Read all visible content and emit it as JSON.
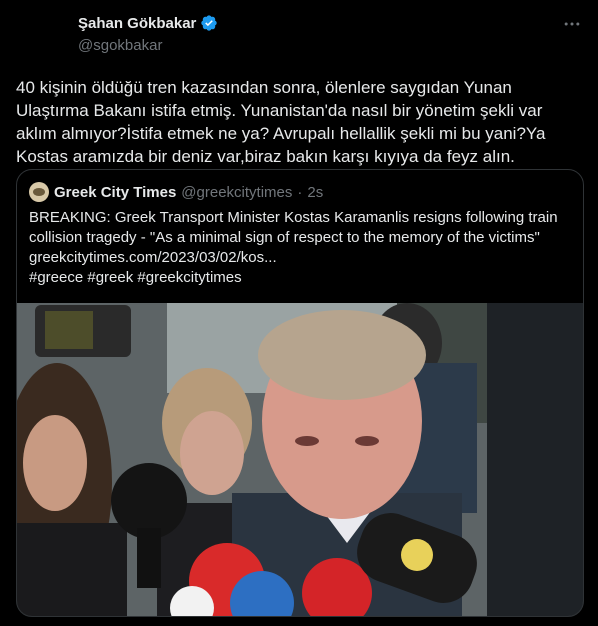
{
  "author": {
    "name": "Şahan Gökbakar",
    "handle": "@sgokbakar",
    "verified_icon": "verified-badge-icon",
    "badge_color": "#1d9bf0"
  },
  "more_icon": "more-horizontal-icon",
  "tweet": {
    "lines": [
      "40 kişinin öldüğü tren kazasından sonra, ölenlere saygıdan Yunan",
      "Ulaştırma Bakanı istifa etmiş. Yunanistan'da nasıl bir yönetim şekli var",
      "aklım almıyor?İstifa etmek ne ya? Avrupalı hellallik şekli mi bu yani?Ya",
      "Kostas aramızda bir deniz var,biraz bakın karşı kıyıya da feyz alın."
    ]
  },
  "quote": {
    "name": "Greek City Times",
    "handle": "@greekcitytimes",
    "separator": "·",
    "time": "2s",
    "lines": [
      "BREAKING: Greek Transport Minister Kostas Karamanlis resigns following train",
      "collision tragedy - \"As a minimal sign of respect to the memory of the victims\"",
      "greekcitytimes.com/2023/03/02/kos...",
      "#greece #greek #greekcitytimes"
    ]
  },
  "colors": {
    "background": "#000000",
    "text": "#e7e9ea",
    "muted": "#71767b",
    "border": "#2f3336"
  }
}
